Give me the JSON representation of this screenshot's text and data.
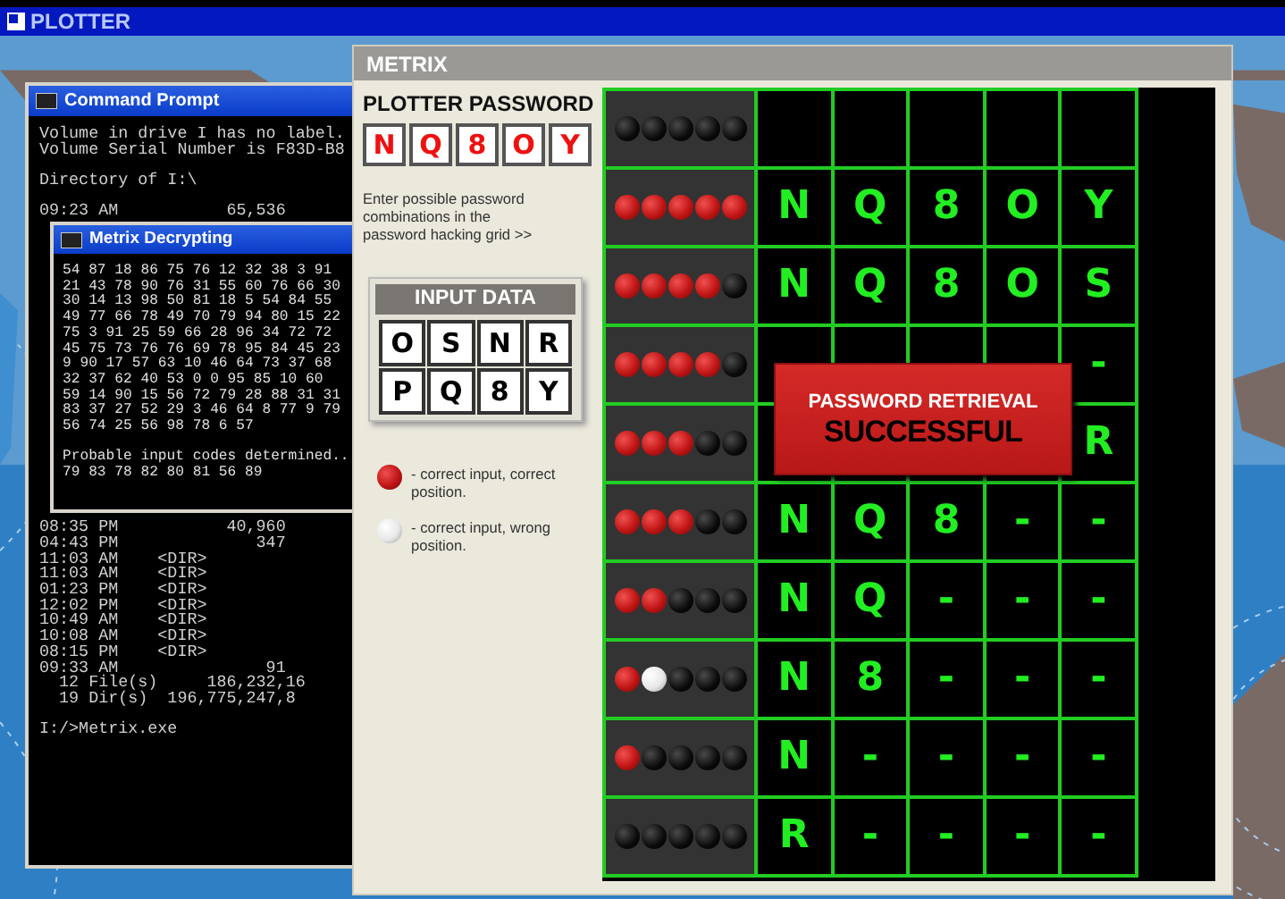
{
  "app_bar": {
    "title": "PLOTTER"
  },
  "command_prompt": {
    "title": "Command Prompt",
    "blocks_top": [
      [
        "Volume in drive I has no label.",
        "Volume Serial Number is F83D-B8"
      ],
      [
        "Directory of I:\\"
      ],
      [
        "09:23 AM           65,536"
      ]
    ],
    "blocks_bottom": [
      [
        "08:35 PM           40,960",
        "04:43 PM              347",
        "11:03 AM    <DIR>",
        "11:03 AM    <DIR>",
        "01:23 PM    <DIR>",
        "12:02 PM    <DIR>",
        "10:49 AM    <DIR>",
        "10:08 AM    <DIR>",
        "08:15 PM    <DIR>",
        "09:33 AM               91",
        "  12 File(s)     186,232,16",
        "  19 Dir(s)  196,775,247,8"
      ],
      [
        "I:/>Metrix.exe"
      ]
    ]
  },
  "decrypt_window": {
    "title": "Metrix Decrypting",
    "blocks": [
      [
        "54 87 18 86 75 76 12 32 38 3 91",
        "21 43 78 90 76 31 55 60 76 66 30",
        "30 14 13 98 50 81 18 5 54 84 55",
        "49 77 66 78 49 70 79 94 80 15 22",
        "75 3 91 25 59 66 28 96 34 72 72",
        "45 75 73 76 76 69 78 95 84 45 23",
        "9 90 17 57 63 10 46 64 73 37 68",
        "32 37 62 40 53 0 0 95 85 10 60",
        "59 14 90 15 56 72 79 28 88 31 31",
        "83 37 27 52 29 3 46 64 8 77 9 79",
        "56 74 25 56 98 78 6 57"
      ],
      [
        "Probable input codes determined..",
        "79 83 78 82 80 81 56 89"
      ]
    ]
  },
  "metrix": {
    "title": "METRIX",
    "password_label": "PLOTTER PASSWORD",
    "password": [
      "N",
      "Q",
      "8",
      "O",
      "Y"
    ],
    "instructions": "Enter possible password combinations in the password hacking grid >>",
    "input_data": {
      "title": "INPUT DATA",
      "keys": [
        "O",
        "S",
        "N",
        "R",
        "P",
        "Q",
        "8",
        "Y"
      ]
    },
    "legend": [
      {
        "kind": "red",
        "text": "- correct input, correct position."
      },
      {
        "kind": "white",
        "text": "- correct input, wrong position."
      }
    ],
    "grid": [
      {
        "pegs": [
          {
            "kind": "black"
          },
          {
            "kind": "black"
          },
          {
            "kind": "black"
          },
          {
            "kind": "black"
          },
          {
            "kind": "black"
          }
        ],
        "cells": [
          null,
          null,
          null,
          null,
          null
        ]
      },
      {
        "pegs": [
          {
            "kind": "red"
          },
          {
            "kind": "red"
          },
          {
            "kind": "red"
          },
          {
            "kind": "red"
          },
          {
            "kind": "red"
          }
        ],
        "cells": [
          "N",
          "Q",
          "8",
          "O",
          "Y"
        ]
      },
      {
        "pegs": [
          {
            "kind": "red"
          },
          {
            "kind": "red"
          },
          {
            "kind": "red"
          },
          {
            "kind": "red"
          },
          {
            "kind": "black"
          }
        ],
        "cells": [
          "N",
          "Q",
          "8",
          "O",
          "S"
        ]
      },
      {
        "pegs": [
          {
            "kind": "red"
          },
          {
            "kind": "red"
          },
          {
            "kind": "red"
          },
          {
            "kind": "red"
          },
          {
            "kind": "black"
          }
        ],
        "cells": [
          null,
          null,
          null,
          null,
          "-"
        ]
      },
      {
        "pegs": [
          {
            "kind": "red"
          },
          {
            "kind": "red"
          },
          {
            "kind": "red"
          },
          {
            "kind": "black"
          },
          {
            "kind": "black"
          }
        ],
        "cells": [
          null,
          null,
          null,
          null,
          "R"
        ]
      },
      {
        "pegs": [
          {
            "kind": "red"
          },
          {
            "kind": "red"
          },
          {
            "kind": "red"
          },
          {
            "kind": "black"
          },
          {
            "kind": "black"
          }
        ],
        "cells": [
          "N",
          "Q",
          "8",
          "-",
          "-"
        ]
      },
      {
        "pegs": [
          {
            "kind": "red"
          },
          {
            "kind": "red"
          },
          {
            "kind": "black"
          },
          {
            "kind": "black"
          },
          {
            "kind": "black"
          }
        ],
        "cells": [
          "N",
          "Q",
          "-",
          "-",
          "-"
        ]
      },
      {
        "pegs": [
          {
            "kind": "red"
          },
          {
            "kind": "white"
          },
          {
            "kind": "black"
          },
          {
            "kind": "black"
          },
          {
            "kind": "black"
          }
        ],
        "cells": [
          "N",
          "8",
          "-",
          "-",
          "-"
        ]
      },
      {
        "pegs": [
          {
            "kind": "red"
          },
          {
            "kind": "black"
          },
          {
            "kind": "black"
          },
          {
            "kind": "black"
          },
          {
            "kind": "black"
          }
        ],
        "cells": [
          "N",
          "-",
          "-",
          "-",
          "-"
        ]
      },
      {
        "pegs": [
          {
            "kind": "black"
          },
          {
            "kind": "black"
          },
          {
            "kind": "black"
          },
          {
            "kind": "black"
          },
          {
            "kind": "black"
          }
        ],
        "cells": [
          "R",
          "-",
          "-",
          "-",
          "-"
        ]
      }
    ],
    "banner": {
      "line1": "PASSWORD RETRIEVAL",
      "line2": "SUCCESSFUL"
    }
  }
}
